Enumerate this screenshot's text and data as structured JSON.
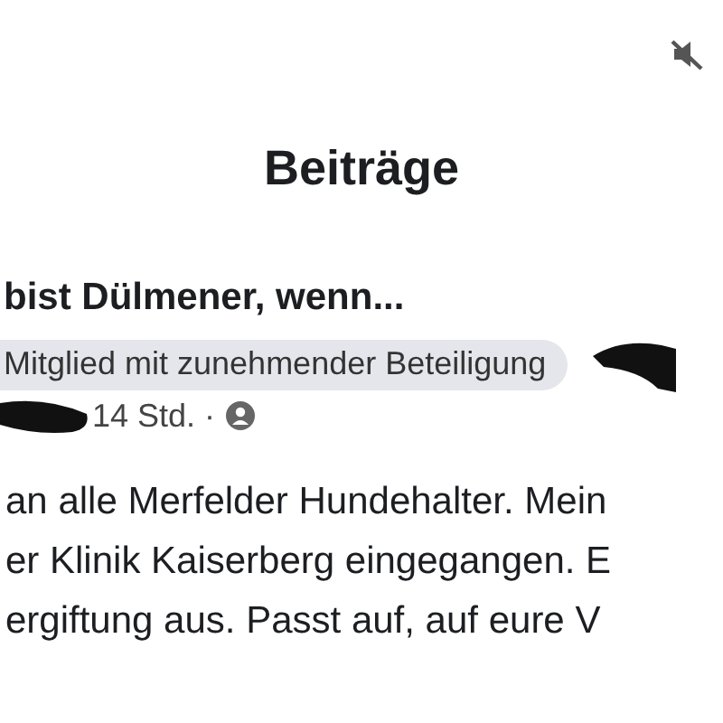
{
  "status_bar": {
    "muted": true
  },
  "header": {
    "title": "Beiträge"
  },
  "post": {
    "group_name": "bist Dülmener, wenn...",
    "badge": "Mitglied mit zunehmender Beteiligung",
    "time": "14 Std.",
    "separator": "·",
    "lines": [
      "an alle Merfelder Hundehalter. Mein",
      "er Klinik Kaiserberg eingegangen. E",
      "ergiftung aus. Passt auf, auf eure V"
    ]
  }
}
